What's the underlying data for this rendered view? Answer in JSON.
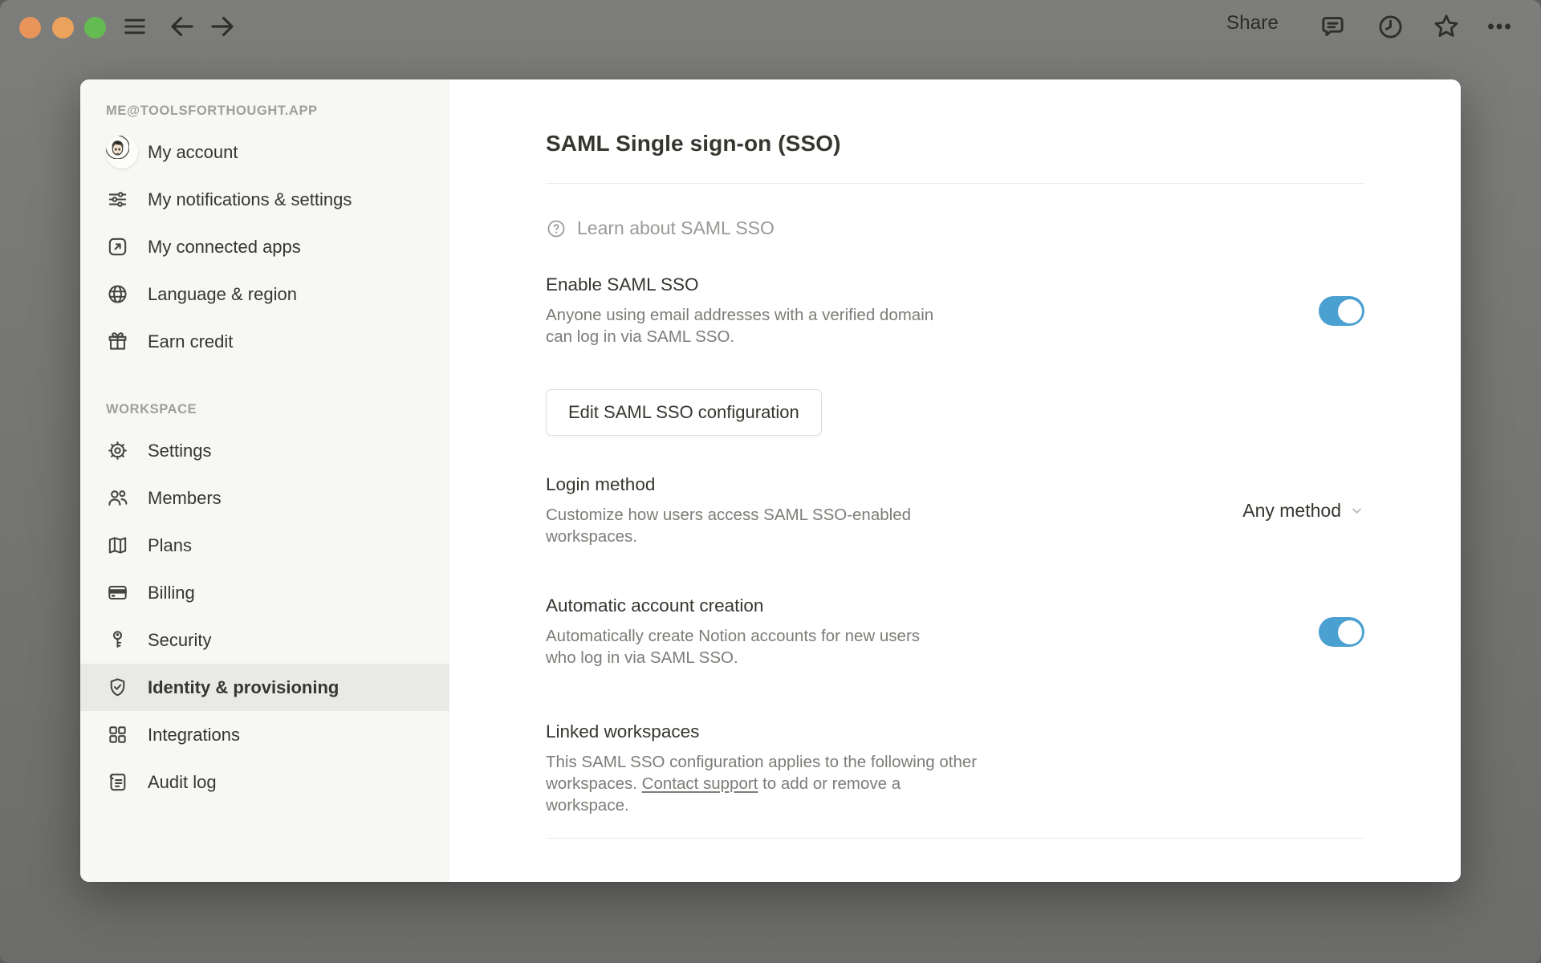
{
  "topbar": {
    "share_label": "Share"
  },
  "sidebar": {
    "account_section_title": "ME@TOOLSFORTHOUGHT.APP",
    "account_items": [
      {
        "label": "My account",
        "icon": "avatar"
      },
      {
        "label": "My notifications & settings",
        "icon": "sliders-icon"
      },
      {
        "label": "My connected apps",
        "icon": "connected-apps-icon"
      },
      {
        "label": "Language & region",
        "icon": "globe-icon"
      },
      {
        "label": "Earn credit",
        "icon": "gift-icon"
      }
    ],
    "workspace_section_title": "WORKSPACE",
    "workspace_items": [
      {
        "label": "Settings",
        "icon": "gear-icon",
        "selected": false
      },
      {
        "label": "Members",
        "icon": "members-icon",
        "selected": false
      },
      {
        "label": "Plans",
        "icon": "map-icon",
        "selected": false
      },
      {
        "label": "Billing",
        "icon": "credit-card-icon",
        "selected": false
      },
      {
        "label": "Security",
        "icon": "key-icon",
        "selected": false
      },
      {
        "label": "Identity & provisioning",
        "icon": "shield-check-icon",
        "selected": true
      },
      {
        "label": "Integrations",
        "icon": "grid-icon",
        "selected": false
      },
      {
        "label": "Audit log",
        "icon": "audit-log-icon",
        "selected": false
      }
    ]
  },
  "main": {
    "title": "SAML Single sign-on (SSO)",
    "learn_link": "Learn about SAML SSO",
    "enable_saml": {
      "heading": "Enable SAML SSO",
      "description": "Anyone using email addresses with a verified domain can log in via SAML SSO.",
      "toggle": "on"
    },
    "edit_button_label": "Edit SAML SSO configuration",
    "login_method": {
      "heading": "Login method",
      "description": "Customize how users access SAML SSO-enabled workspaces.",
      "selected_value": "Any method"
    },
    "auto_account": {
      "heading": "Automatic account creation",
      "description": "Automatically create Notion accounts for new users who log in via SAML SSO.",
      "toggle": "on"
    },
    "linked_workspaces": {
      "heading": "Linked workspaces",
      "description_before": "This SAML SSO configuration applies to the following other workspaces. ",
      "link_label": "Contact support",
      "description_after": " to add or remove a workspace."
    }
  },
  "colors": {
    "toggle_on": "#4ba0d2",
    "selected_item_bg": "#e9e9e7",
    "sidebar_bg": "#f7f7f5",
    "window_chrome": "#767674",
    "traffic_red": "#e8945a",
    "traffic_yellow": "#eba25c",
    "traffic_green": "#63bb52"
  }
}
